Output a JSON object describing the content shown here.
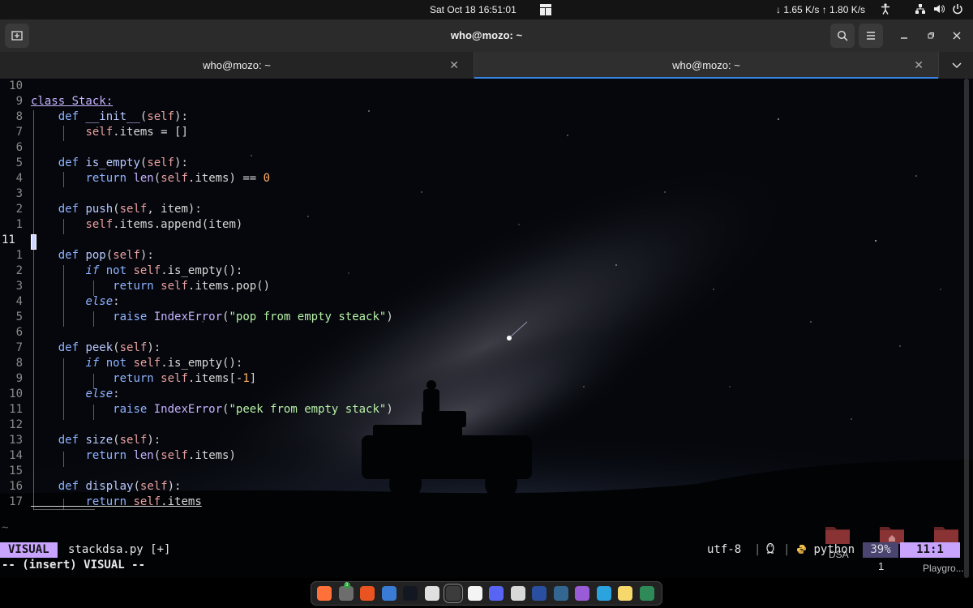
{
  "system_bar": {
    "clock": "Sat Oct 18  16:51:01",
    "network": "↓ 1.65 K/s ↑ 1.80 K/s",
    "tray_icons": [
      "accessibility-icon",
      "network-icon",
      "volume-icon",
      "power-icon"
    ]
  },
  "window": {
    "title": "who@mozo: ~",
    "buttons": [
      "new-tab-icon",
      "search-icon",
      "hamburger-menu-icon",
      "minimize-icon",
      "restore-icon",
      "close-icon"
    ]
  },
  "tabs": [
    {
      "label": "who@mozo: ~",
      "active": false
    },
    {
      "label": "who@mozo: ~",
      "active": true
    }
  ],
  "editor": {
    "code_lines": [
      {
        "num": "10",
        "text": ""
      },
      {
        "num": "9",
        "text": "class Stack:"
      },
      {
        "num": "8",
        "text": "    def __init__(self):"
      },
      {
        "num": "7",
        "text": "        self.items = []"
      },
      {
        "num": "6",
        "text": ""
      },
      {
        "num": "5",
        "text": "    def is_empty(self):"
      },
      {
        "num": "4",
        "text": "        return len(self.items) == 0"
      },
      {
        "num": "3",
        "text": ""
      },
      {
        "num": "2",
        "text": "    def push(self, item):"
      },
      {
        "num": "1",
        "text": "        self.items.append(item)"
      },
      {
        "num": "11",
        "text": ""
      },
      {
        "num": "1",
        "text": "    def pop(self):"
      },
      {
        "num": "2",
        "text": "        if not self.is_empty():"
      },
      {
        "num": "3",
        "text": "            return self.items.pop()"
      },
      {
        "num": "4",
        "text": "        else:"
      },
      {
        "num": "5",
        "text": "            raise IndexError(\"pop from empty steack\")"
      },
      {
        "num": "6",
        "text": ""
      },
      {
        "num": "7",
        "text": "    def peek(self):"
      },
      {
        "num": "8",
        "text": "        if not self.is_empty():"
      },
      {
        "num": "9",
        "text": "            return self.items[-1]"
      },
      {
        "num": "10",
        "text": "        else:"
      },
      {
        "num": "11",
        "text": "            raise IndexError(\"peek from empty stack\")"
      },
      {
        "num": "12",
        "text": ""
      },
      {
        "num": "13",
        "text": "    def size(self):"
      },
      {
        "num": "14",
        "text": "        return len(self.items)"
      },
      {
        "num": "15",
        "text": ""
      },
      {
        "num": "16",
        "text": "    def display(self):"
      },
      {
        "num": "17",
        "text": "        return self.items"
      }
    ],
    "empty_line_marker": "~",
    "status": {
      "mode": "VISUAL",
      "filename": "stackdsa.py [+]",
      "encoding": "utf-8",
      "separator": "|",
      "os_icon": "linux-penguin-icon",
      "filetype_icon": "python-icon",
      "filetype": "python",
      "percent": "39%",
      "position": "11:1"
    },
    "command_line": "-- (insert) VISUAL --"
  },
  "desktop": {
    "items": [
      {
        "label": "DSA",
        "icon": "folder-icon"
      },
      {
        "label": "",
        "icon": "home-folder-icon"
      },
      {
        "label": "Playgro...",
        "icon": "folder-icon"
      }
    ],
    "workspace_number": "1"
  },
  "dock": {
    "apps": [
      {
        "name": "firefox-icon",
        "color": "#ff7139"
      },
      {
        "name": "files-icon",
        "color": "#6d6d6d",
        "badge": "3"
      },
      {
        "name": "software-center-icon",
        "color": "#e95420"
      },
      {
        "name": "help-icon",
        "color": "#3a7bd5"
      },
      {
        "name": "tradingview-icon",
        "color": "#131722"
      },
      {
        "name": "inkscape-icon",
        "color": "#e0e0e0"
      },
      {
        "name": "terminal-icon",
        "color": "#3c3c3c",
        "active": true
      },
      {
        "name": "text-editor-icon",
        "color": "#f4f4f4"
      },
      {
        "name": "discord-icon",
        "color": "#5865f2"
      },
      {
        "name": "chatgpt-icon",
        "color": "#d8d8d8"
      },
      {
        "name": "mullvad-icon",
        "color": "#2a4fa0"
      },
      {
        "name": "postgres-icon",
        "color": "#336791"
      },
      {
        "name": "obsidian-icon",
        "color": "#9a5bd6"
      },
      {
        "name": "telegram-icon",
        "color": "#2aa3df"
      },
      {
        "name": "notes-icon",
        "color": "#f7d96b"
      },
      {
        "name": "calc-icon",
        "color": "#2e8b57"
      }
    ]
  }
}
